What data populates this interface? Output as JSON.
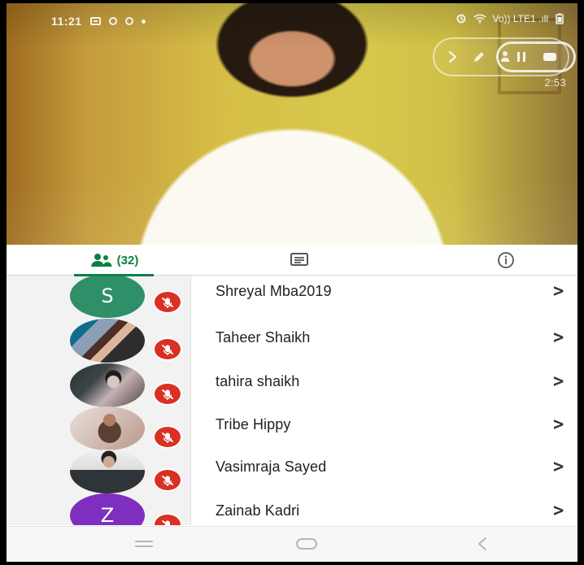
{
  "status_bar": {
    "time": "11:21",
    "right_text": "Vo)) LTE1 .ıll"
  },
  "call": {
    "recording_time": "2:53"
  },
  "tabs": {
    "participants_count": "(32)"
  },
  "participants": [
    {
      "name": "Shreyal Mba2019",
      "avatar_letter": "S",
      "avatar_color": "#2f8f68",
      "chevron": ">"
    },
    {
      "name": "Taheer Shaikh",
      "avatar_letter": "",
      "avatar_color": "#8fb0c9",
      "chevron": ">"
    },
    {
      "name": "tahira shaikh",
      "avatar_letter": "",
      "avatar_color": "#6f7b7d",
      "chevron": ">"
    },
    {
      "name": "Tribe Hippy",
      "avatar_letter": "",
      "avatar_color": "#c8b3a7",
      "chevron": ">"
    },
    {
      "name": "Vasimraja Sayed",
      "avatar_letter": "",
      "avatar_color": "#9e9995",
      "chevron": ">"
    },
    {
      "name": "Zainab Kadri",
      "avatar_letter": "Z",
      "avatar_color": "#7e2fbf",
      "chevron": ">"
    }
  ],
  "colors": {
    "accent": "#0b8043",
    "mute_red": "#d93025",
    "avatar_column": "#f2f2f2"
  },
  "icons": {
    "tab_participants": "people-icon",
    "tab_chat": "chat-icon",
    "tab_info": "info-icon",
    "mute": "mic-off-icon",
    "nav_menu": "menu-icon",
    "nav_home": "home-icon",
    "nav_back": "back-icon"
  }
}
